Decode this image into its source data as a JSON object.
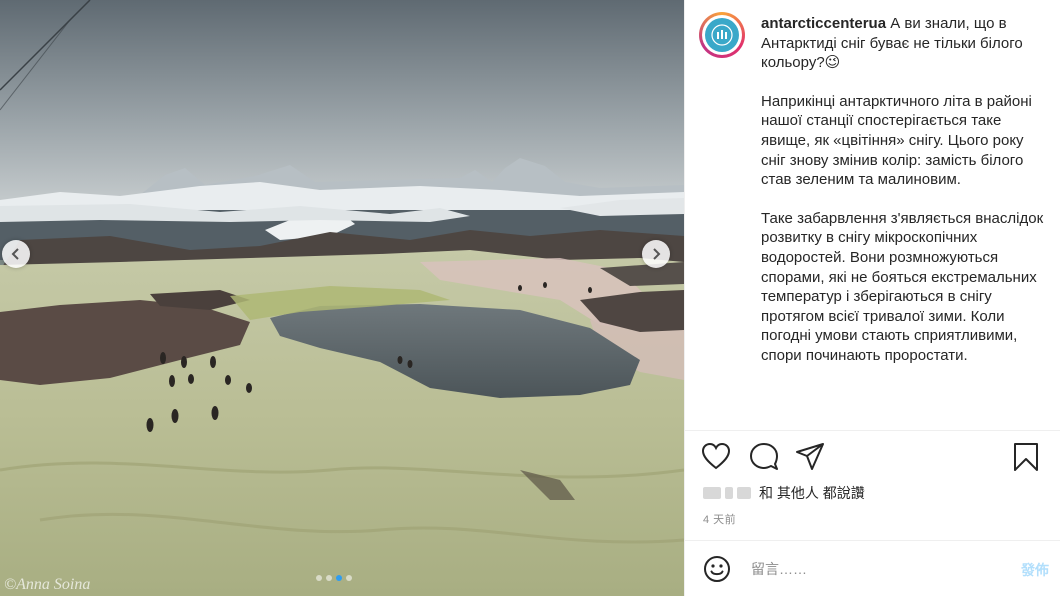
{
  "post": {
    "username": "antarcticcenterua",
    "caption_paragraphs": [
      "А ви знали, що в Антарктиді сніг буває не тільки білого кольору?😉",
      "Наприкінці антарктичного літа в районі нашої станції спостерігається таке явище, як «цвітіння» снігу. Цього року сніг знову змінив колір: замість білого став зеленим та малиновим.",
      "Таке забарвлення з'являється внаслідок розвитку в снігу мікроскопічних водоростей. Вони розмножуються спорами, які не бояться екстремальних температур і зберігаються в снігу протягом всієї тривалої зими. Коли погодні умови стають сприятливими, спори починають проростати."
    ],
    "likes_suffix": "和 其他人 都說讚",
    "time_ago": "4 天前"
  },
  "photo": {
    "watermark": "©Anna Soina",
    "slide_count": 4,
    "active_slide": 3
  },
  "actions": {
    "like_icon": "heart-icon",
    "comment_icon": "comment-icon",
    "share_icon": "share-icon",
    "save_icon": "bookmark-icon"
  },
  "comment": {
    "emoji_icon": "smiley-icon",
    "placeholder": "留言……",
    "post_label": "發佈"
  },
  "colors": {
    "accent_disabled": "#b2dffc",
    "active_dot": "#2f9df0",
    "secondary_text": "#8e8e8e"
  }
}
